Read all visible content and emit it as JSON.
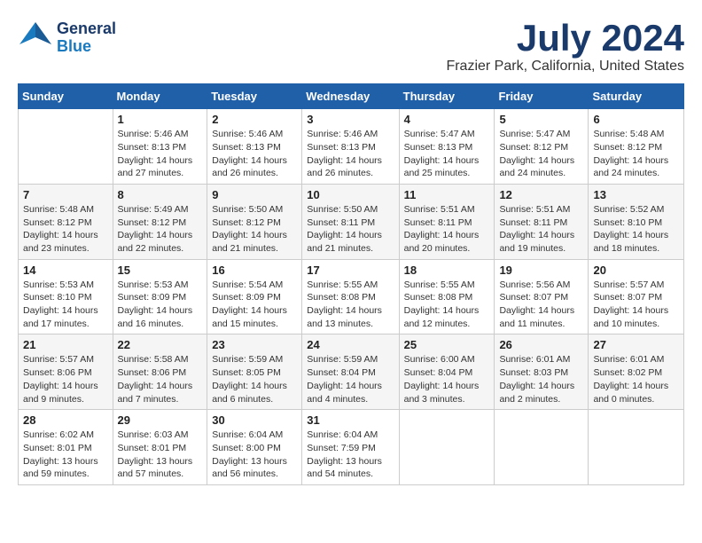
{
  "header": {
    "logo_general": "General",
    "logo_blue": "Blue",
    "month_title": "July 2024",
    "location": "Frazier Park, California, United States"
  },
  "calendar": {
    "days_of_week": [
      "Sunday",
      "Monday",
      "Tuesday",
      "Wednesday",
      "Thursday",
      "Friday",
      "Saturday"
    ],
    "weeks": [
      [
        {
          "day": "",
          "sunrise": "",
          "sunset": "",
          "daylight": ""
        },
        {
          "day": "1",
          "sunrise": "Sunrise: 5:46 AM",
          "sunset": "Sunset: 8:13 PM",
          "daylight": "Daylight: 14 hours and 27 minutes."
        },
        {
          "day": "2",
          "sunrise": "Sunrise: 5:46 AM",
          "sunset": "Sunset: 8:13 PM",
          "daylight": "Daylight: 14 hours and 26 minutes."
        },
        {
          "day": "3",
          "sunrise": "Sunrise: 5:46 AM",
          "sunset": "Sunset: 8:13 PM",
          "daylight": "Daylight: 14 hours and 26 minutes."
        },
        {
          "day": "4",
          "sunrise": "Sunrise: 5:47 AM",
          "sunset": "Sunset: 8:13 PM",
          "daylight": "Daylight: 14 hours and 25 minutes."
        },
        {
          "day": "5",
          "sunrise": "Sunrise: 5:47 AM",
          "sunset": "Sunset: 8:12 PM",
          "daylight": "Daylight: 14 hours and 24 minutes."
        },
        {
          "day": "6",
          "sunrise": "Sunrise: 5:48 AM",
          "sunset": "Sunset: 8:12 PM",
          "daylight": "Daylight: 14 hours and 24 minutes."
        }
      ],
      [
        {
          "day": "7",
          "sunrise": "Sunrise: 5:48 AM",
          "sunset": "Sunset: 8:12 PM",
          "daylight": "Daylight: 14 hours and 23 minutes."
        },
        {
          "day": "8",
          "sunrise": "Sunrise: 5:49 AM",
          "sunset": "Sunset: 8:12 PM",
          "daylight": "Daylight: 14 hours and 22 minutes."
        },
        {
          "day": "9",
          "sunrise": "Sunrise: 5:50 AM",
          "sunset": "Sunset: 8:12 PM",
          "daylight": "Daylight: 14 hours and 21 minutes."
        },
        {
          "day": "10",
          "sunrise": "Sunrise: 5:50 AM",
          "sunset": "Sunset: 8:11 PM",
          "daylight": "Daylight: 14 hours and 21 minutes."
        },
        {
          "day": "11",
          "sunrise": "Sunrise: 5:51 AM",
          "sunset": "Sunset: 8:11 PM",
          "daylight": "Daylight: 14 hours and 20 minutes."
        },
        {
          "day": "12",
          "sunrise": "Sunrise: 5:51 AM",
          "sunset": "Sunset: 8:11 PM",
          "daylight": "Daylight: 14 hours and 19 minutes."
        },
        {
          "day": "13",
          "sunrise": "Sunrise: 5:52 AM",
          "sunset": "Sunset: 8:10 PM",
          "daylight": "Daylight: 14 hours and 18 minutes."
        }
      ],
      [
        {
          "day": "14",
          "sunrise": "Sunrise: 5:53 AM",
          "sunset": "Sunset: 8:10 PM",
          "daylight": "Daylight: 14 hours and 17 minutes."
        },
        {
          "day": "15",
          "sunrise": "Sunrise: 5:53 AM",
          "sunset": "Sunset: 8:09 PM",
          "daylight": "Daylight: 14 hours and 16 minutes."
        },
        {
          "day": "16",
          "sunrise": "Sunrise: 5:54 AM",
          "sunset": "Sunset: 8:09 PM",
          "daylight": "Daylight: 14 hours and 15 minutes."
        },
        {
          "day": "17",
          "sunrise": "Sunrise: 5:55 AM",
          "sunset": "Sunset: 8:08 PM",
          "daylight": "Daylight: 14 hours and 13 minutes."
        },
        {
          "day": "18",
          "sunrise": "Sunrise: 5:55 AM",
          "sunset": "Sunset: 8:08 PM",
          "daylight": "Daylight: 14 hours and 12 minutes."
        },
        {
          "day": "19",
          "sunrise": "Sunrise: 5:56 AM",
          "sunset": "Sunset: 8:07 PM",
          "daylight": "Daylight: 14 hours and 11 minutes."
        },
        {
          "day": "20",
          "sunrise": "Sunrise: 5:57 AM",
          "sunset": "Sunset: 8:07 PM",
          "daylight": "Daylight: 14 hours and 10 minutes."
        }
      ],
      [
        {
          "day": "21",
          "sunrise": "Sunrise: 5:57 AM",
          "sunset": "Sunset: 8:06 PM",
          "daylight": "Daylight: 14 hours and 9 minutes."
        },
        {
          "day": "22",
          "sunrise": "Sunrise: 5:58 AM",
          "sunset": "Sunset: 8:06 PM",
          "daylight": "Daylight: 14 hours and 7 minutes."
        },
        {
          "day": "23",
          "sunrise": "Sunrise: 5:59 AM",
          "sunset": "Sunset: 8:05 PM",
          "daylight": "Daylight: 14 hours and 6 minutes."
        },
        {
          "day": "24",
          "sunrise": "Sunrise: 5:59 AM",
          "sunset": "Sunset: 8:04 PM",
          "daylight": "Daylight: 14 hours and 4 minutes."
        },
        {
          "day": "25",
          "sunrise": "Sunrise: 6:00 AM",
          "sunset": "Sunset: 8:04 PM",
          "daylight": "Daylight: 14 hours and 3 minutes."
        },
        {
          "day": "26",
          "sunrise": "Sunrise: 6:01 AM",
          "sunset": "Sunset: 8:03 PM",
          "daylight": "Daylight: 14 hours and 2 minutes."
        },
        {
          "day": "27",
          "sunrise": "Sunrise: 6:01 AM",
          "sunset": "Sunset: 8:02 PM",
          "daylight": "Daylight: 14 hours and 0 minutes."
        }
      ],
      [
        {
          "day": "28",
          "sunrise": "Sunrise: 6:02 AM",
          "sunset": "Sunset: 8:01 PM",
          "daylight": "Daylight: 13 hours and 59 minutes."
        },
        {
          "day": "29",
          "sunrise": "Sunrise: 6:03 AM",
          "sunset": "Sunset: 8:01 PM",
          "daylight": "Daylight: 13 hours and 57 minutes."
        },
        {
          "day": "30",
          "sunrise": "Sunrise: 6:04 AM",
          "sunset": "Sunset: 8:00 PM",
          "daylight": "Daylight: 13 hours and 56 minutes."
        },
        {
          "day": "31",
          "sunrise": "Sunrise: 6:04 AM",
          "sunset": "Sunset: 7:59 PM",
          "daylight": "Daylight: 13 hours and 54 minutes."
        },
        {
          "day": "",
          "sunrise": "",
          "sunset": "",
          "daylight": ""
        },
        {
          "day": "",
          "sunrise": "",
          "sunset": "",
          "daylight": ""
        },
        {
          "day": "",
          "sunrise": "",
          "sunset": "",
          "daylight": ""
        }
      ]
    ]
  }
}
